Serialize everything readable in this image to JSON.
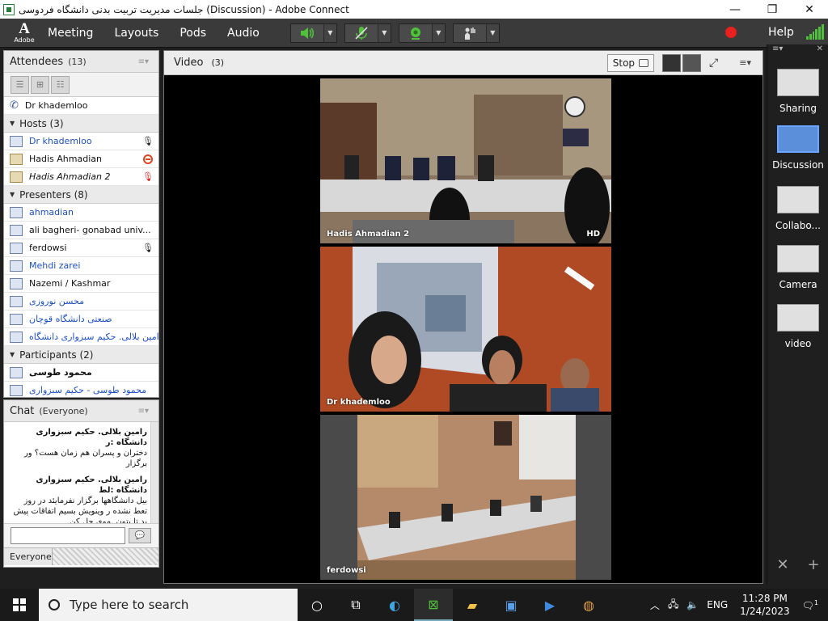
{
  "window": {
    "title": "جلسات مدیریت تربیت بدنی دانشگاه فردوسی (Discussion) - Adobe Connect",
    "minimize": "—",
    "maximize": "❐",
    "close": "✕"
  },
  "menubar": {
    "logo_label": "Adobe",
    "items": [
      "Meeting",
      "Layouts",
      "Pods",
      "Audio"
    ],
    "help": "Help",
    "record_color": "#e8201e"
  },
  "attendees": {
    "title": "Attendees",
    "count": "(13)",
    "me": "Dr khademloo",
    "hosts": {
      "header": "Hosts (3)",
      "items": [
        {
          "name": "Dr khademloo",
          "status": "mic"
        },
        {
          "name": "Hadis Ahmadian",
          "status": "blocked"
        },
        {
          "name": "Hadis Ahmadian 2",
          "status": "mic-off"
        }
      ]
    },
    "presenters": {
      "header": "Presenters (8)",
      "items": [
        {
          "name": "ahmadian",
          "status": ""
        },
        {
          "name": "ali bagheri- gonabad univ...",
          "status": ""
        },
        {
          "name": "ferdowsi",
          "status": "mic"
        },
        {
          "name": "Mehdi zarei",
          "status": ""
        },
        {
          "name": "Nazemi / Kashmar",
          "status": ""
        },
        {
          "name": "محسن نوروزی",
          "status": ""
        },
        {
          "name": "صنعتی دانشگاه قوچان",
          "status": ""
        },
        {
          "name": "رامین بلالی. حکیم سبزواری دانشگاه",
          "status": ""
        }
      ]
    },
    "participants": {
      "header": "Participants (2)",
      "items": [
        {
          "name": "محمود طوسی",
          "status": ""
        },
        {
          "name": "محمود طوسی - حکیم سبزواری",
          "status": ""
        }
      ]
    }
  },
  "video": {
    "title": "Video",
    "count": "(3)",
    "stop_label": "Stop",
    "tiles": [
      {
        "name": "Hadis Ahmadian 2",
        "badge": "HD"
      },
      {
        "name": "Dr khademloo",
        "badge": ""
      },
      {
        "name": "ferdowsi",
        "badge": ""
      }
    ]
  },
  "chat": {
    "title": "Chat",
    "scope": "(Everyone)",
    "messages": [
      {
        "sender": "رامین بلالی. حکیم سبزواری دانشگاه :ر",
        "text": "دختران و پسران هم زمان هست؟ ور برگزار"
      },
      {
        "sender": "رامین بلالی. حکیم سبزواری دانشگاه :لط",
        "text": "بیل دانشگاهها برگزار نفرمایئد در روز تعط نشده ر وینویش بسیم اتفاقات پیش بد تا  بتون .موی حل کن"
      }
    ],
    "input_value": "",
    "tab_everyone": "Everyone"
  },
  "layouts_panel": {
    "items": [
      {
        "label": "Sharing",
        "selected": false
      },
      {
        "label": "Discussion",
        "selected": true
      },
      {
        "label": "Collabo...",
        "selected": false
      },
      {
        "label": "Camera",
        "selected": false
      },
      {
        "label": "video",
        "selected": false
      }
    ]
  },
  "taskbar": {
    "search_placeholder": "Type here to search",
    "lang": "ENG",
    "time": "11:28 PM",
    "date": "1/24/2023",
    "notif_count": "1"
  }
}
